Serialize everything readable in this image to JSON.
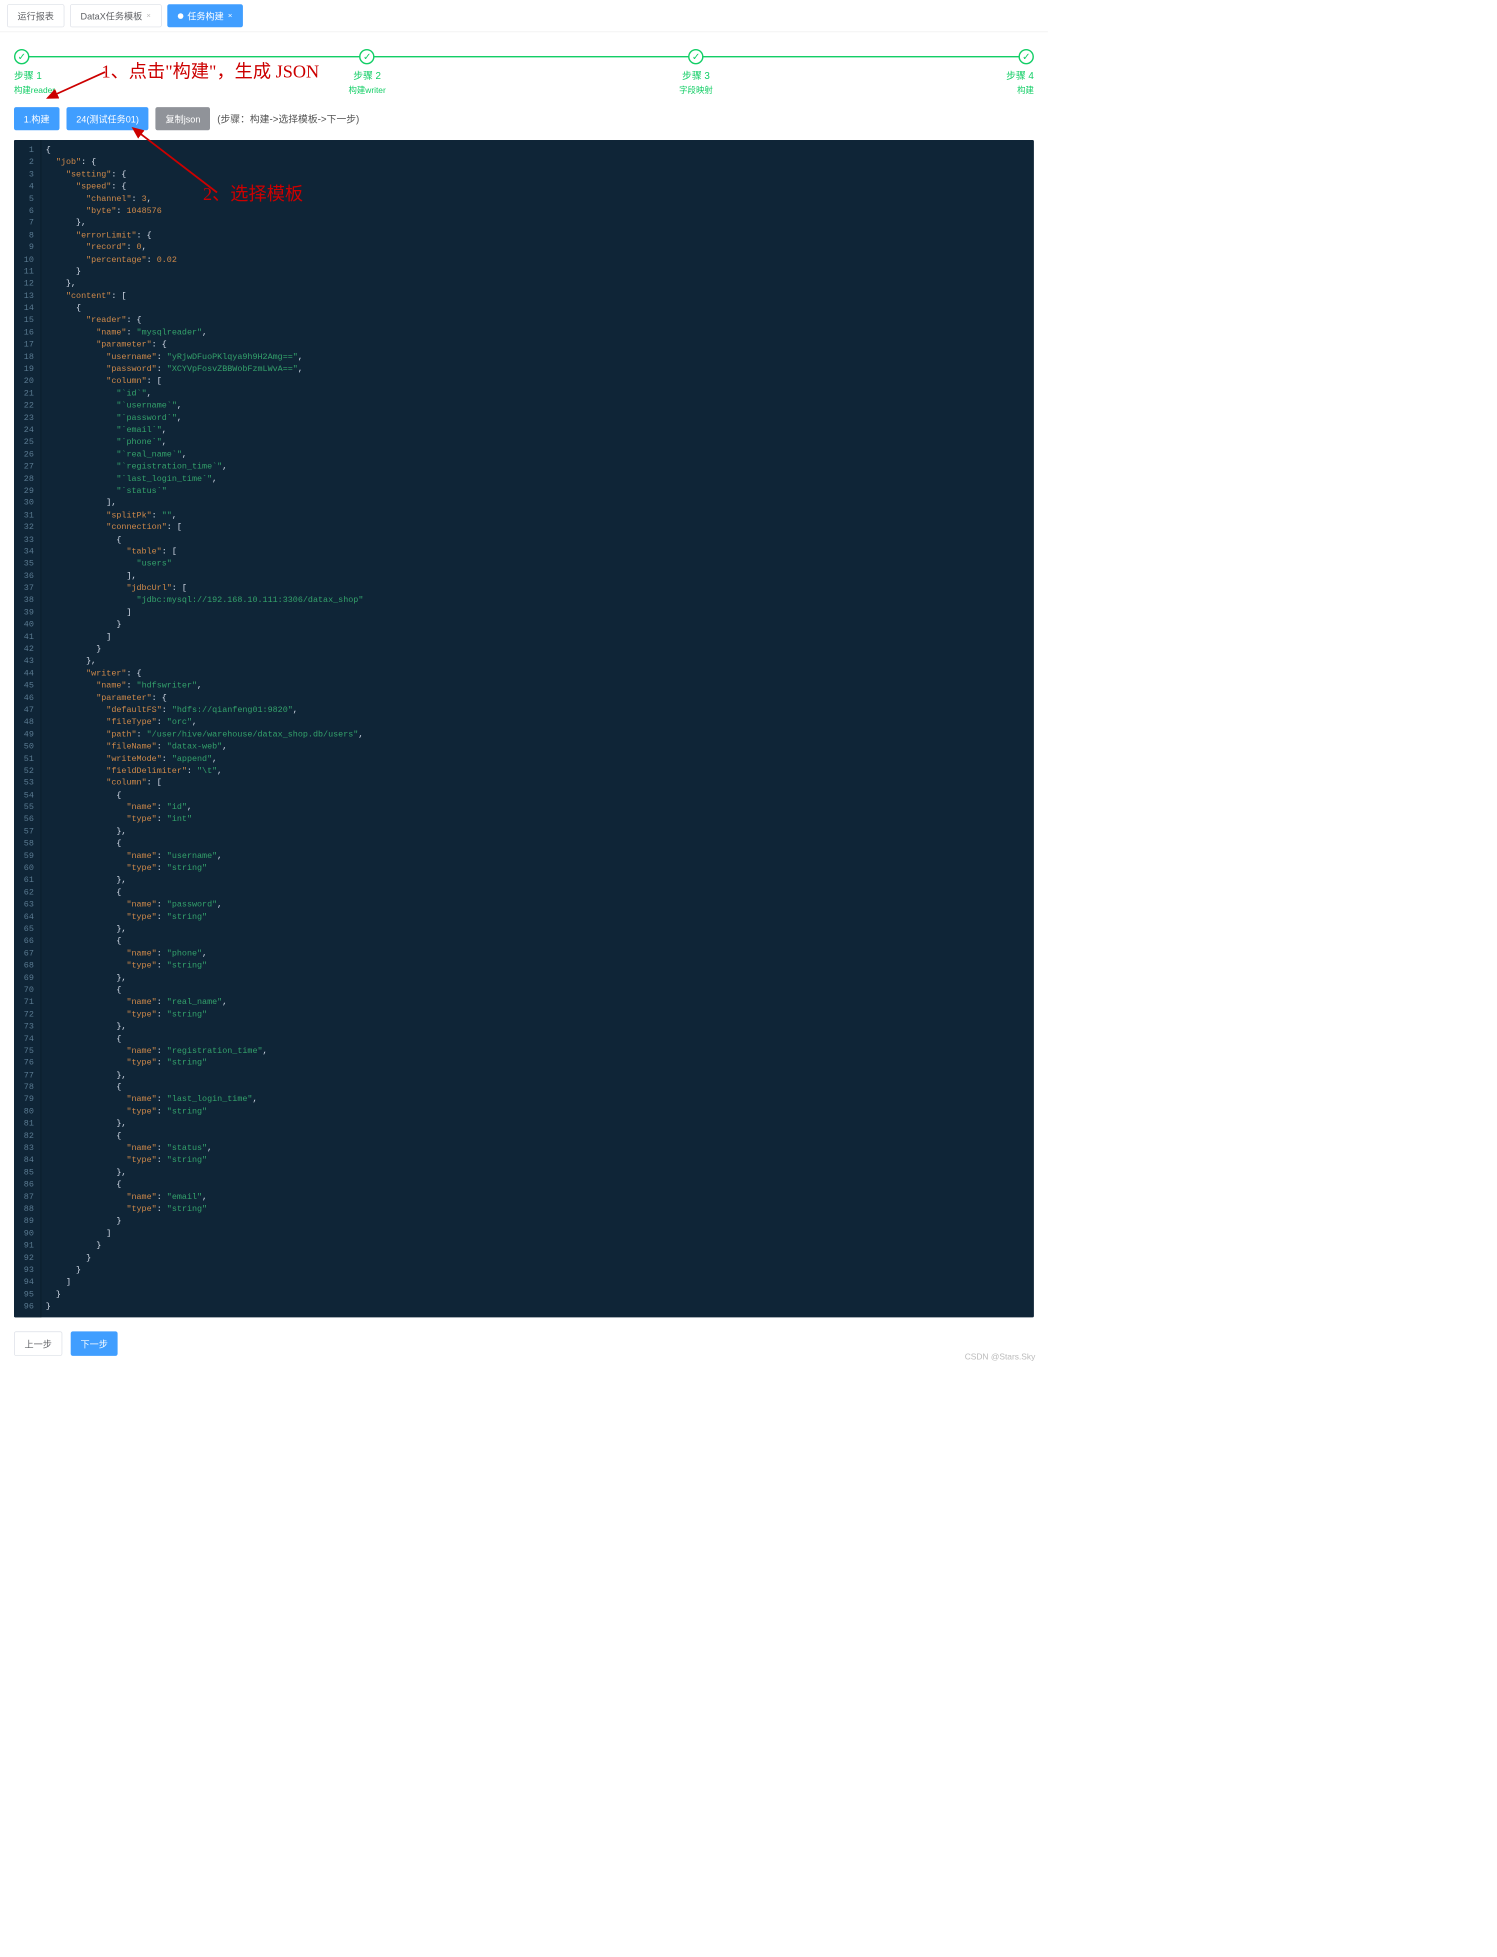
{
  "tabs": {
    "items": [
      {
        "label": "运行报表",
        "closable": false
      },
      {
        "label": "DataX任务模板",
        "closable": true
      },
      {
        "label": "任务构建",
        "closable": true,
        "active": true
      }
    ]
  },
  "steps": {
    "items": [
      {
        "title": "步骤 1",
        "sub": "构建reader"
      },
      {
        "title": "步骤 2",
        "sub": "构建writer"
      },
      {
        "title": "步骤 3",
        "sub": "字段映射"
      },
      {
        "title": "步骤 4",
        "sub": "构建"
      }
    ],
    "check": "✓"
  },
  "toolbar": {
    "build": "1.构建",
    "template": "24(测试任务01)",
    "copy": "复制json",
    "hint": "(步骤：构建->选择模板->下一步)"
  },
  "footer": {
    "prev": "上一步",
    "next": "下一步"
  },
  "annotations": {
    "a1": "1、点击\"构建\"，生成 JSON",
    "a2": "2、选择模板"
  },
  "watermark": "CSDN @Stars.Sky",
  "code": {
    "job": {
      "setting": {
        "speed": {
          "channel": 3,
          "byte": 1048576
        },
        "errorLimit": {
          "record": 0,
          "percentage": 0.02
        }
      },
      "content": [
        {
          "reader": {
            "name": "mysqlreader",
            "parameter": {
              "username": "yRjwDFuoPKlqya9h9H2Amg==",
              "password": "XCYVpFosvZBBWobFzmLWvA==",
              "column": [
                "`id`",
                "`username`",
                "`password`",
                "`email`",
                "`phone`",
                "`real_name`",
                "`registration_time`",
                "`last_login_time`",
                "`status`"
              ],
              "splitPk": "",
              "connection": [
                {
                  "table": [
                    "users"
                  ],
                  "jdbcUrl": [
                    "jdbc:mysql://192.168.10.111:3306/datax_shop"
                  ]
                }
              ]
            }
          },
          "writer": {
            "name": "hdfswriter",
            "parameter": {
              "defaultFS": "hdfs://qianfeng01:9820",
              "fileType": "orc",
              "path": "/user/hive/warehouse/datax_shop.db/users",
              "fileName": "datax-web",
              "writeMode": "append",
              "fieldDelimiter": "\\t",
              "column": [
                {
                  "name": "id",
                  "type": "int"
                },
                {
                  "name": "username",
                  "type": "string"
                },
                {
                  "name": "password",
                  "type": "string"
                },
                {
                  "name": "phone",
                  "type": "string"
                },
                {
                  "name": "real_name",
                  "type": "string"
                },
                {
                  "name": "registration_time",
                  "type": "string"
                },
                {
                  "name": "last_login_time",
                  "type": "string"
                },
                {
                  "name": "status",
                  "type": "string"
                },
                {
                  "name": "email",
                  "type": "string"
                }
              ]
            }
          }
        }
      ]
    }
  }
}
